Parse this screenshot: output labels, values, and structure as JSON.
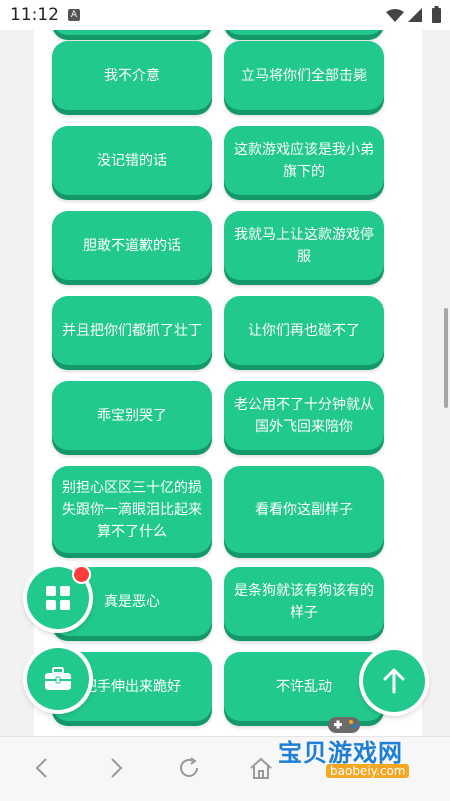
{
  "status_bar": {
    "time": "11:12",
    "notif_icon": "A"
  },
  "buttons": [
    {
      "label": ""
    },
    {
      "label": ""
    },
    {
      "label": "我不介意"
    },
    {
      "label": "立马将你们全部击毙"
    },
    {
      "label": "没记错的话"
    },
    {
      "label": "这款游戏应该是我小弟旗下的"
    },
    {
      "label": "胆敢不道歉的话"
    },
    {
      "label": "我就马上让这款游戏停服"
    },
    {
      "label": "并且把你们都抓了壮丁"
    },
    {
      "label": "让你们再也碰不了"
    },
    {
      "label": "乖宝别哭了"
    },
    {
      "label": "老公用不了十分钟就从国外飞回来陪你"
    },
    {
      "label": "别担心区区三十亿的损失跟你一滴眼泪比起来算不了什么"
    },
    {
      "label": "看看你这副样子"
    },
    {
      "label": "真是恶心"
    },
    {
      "label": "是条狗就该有狗该有的样子"
    },
    {
      "label": "把手伸出来跪好"
    },
    {
      "label": "不许乱动"
    },
    {
      "label": ""
    },
    {
      "label": ""
    }
  ],
  "watermark": {
    "brand": "宝贝游戏网",
    "domain": "baobeiy.com"
  },
  "colors": {
    "button_green": "#22c98d",
    "button_shadow": "#159869",
    "badge_red": "#ff3b3b"
  }
}
